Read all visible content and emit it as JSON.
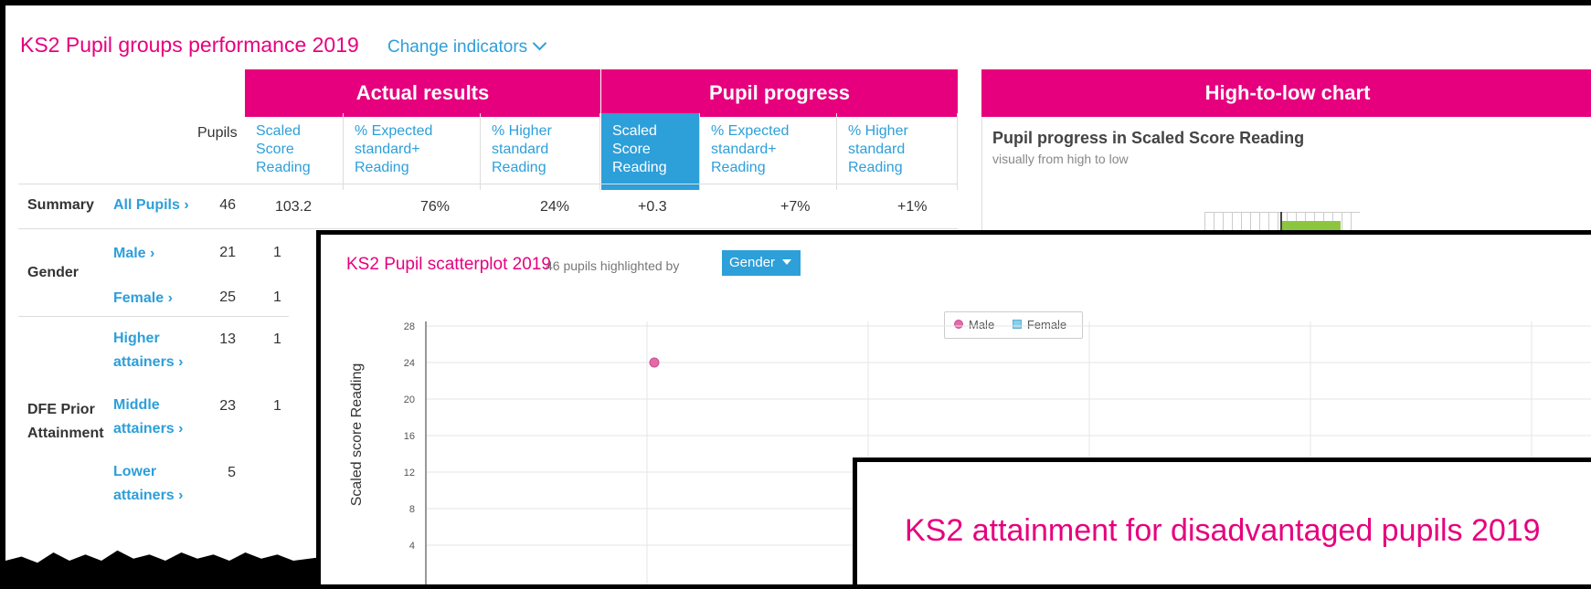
{
  "performance": {
    "title": "KS2 Pupil groups performance 2019",
    "change_indicators": "Change indicators",
    "headers": {
      "actual": "Actual results",
      "progress": "Pupil progress",
      "chart": "High-to-low chart"
    },
    "pupils_label": "Pupils",
    "columns": [
      "Scaled Score Reading",
      "% Expected standard+ Reading",
      "% Higher standard Reading",
      "Scaled Score Reading",
      "% Expected standard+ Reading",
      "% Higher standard Reading"
    ],
    "rows": [
      {
        "category": "Summary",
        "group": "All Pupils ›",
        "pupils": "46",
        "values": [
          "103.2",
          "76%",
          "24%",
          "+0.3",
          "+7%",
          "+1%"
        ]
      },
      {
        "category": "Gender",
        "group": "Male ›",
        "pupils": "21",
        "values": [
          "1",
          "",
          "",
          "",
          "",
          ""
        ]
      },
      {
        "category": "",
        "group": "Female ›",
        "pupils": "25",
        "values": [
          "1",
          "",
          "",
          "",
          "",
          ""
        ]
      },
      {
        "category": "DFE Prior Attainment",
        "group": "Higher attainers ›",
        "pupils": "13",
        "values": [
          "1",
          "",
          "",
          "",
          "",
          ""
        ]
      },
      {
        "category": "",
        "group": "Middle attainers ›",
        "pupils": "23",
        "values": [
          "1",
          "",
          "",
          "",
          "",
          ""
        ]
      },
      {
        "category": "",
        "group": "Lower attainers ›",
        "pupils": "5",
        "values": [
          "",
          "",
          "",
          "",
          "",
          ""
        ]
      }
    ],
    "chart_panel": {
      "title": "Pupil progress in Scaled Score Reading",
      "subtitle": "visually from high to low"
    }
  },
  "scatter": {
    "title": "KS2 Pupil scatterplot 2019",
    "highlighted": "46 pupils highlighted by",
    "gender_select": "Gender",
    "legend": [
      "Male",
      "Female"
    ],
    "ylabel": "Scaled score Reading",
    "colors": {
      "male": "#e46aa9",
      "female": "#8ccde9"
    }
  },
  "disadvantaged": {
    "title": "KS2 attainment for disadvantaged pupils 2019"
  },
  "chart_data": {
    "type": "scatter",
    "title": "KS2 Pupil scatterplot 2019",
    "ylabel": "Scaled score Reading",
    "yticks": [
      4,
      8,
      12,
      16,
      20,
      24,
      28
    ],
    "series": [
      {
        "name": "Male",
        "points": [
          [
            1,
            24
          ]
        ]
      },
      {
        "name": "Female",
        "points": []
      }
    ]
  }
}
